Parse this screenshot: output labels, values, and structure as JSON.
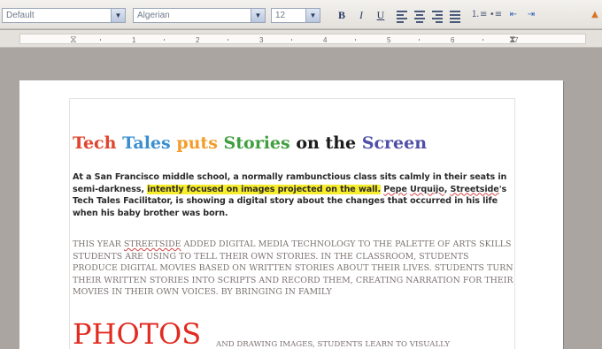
{
  "toolbar": {
    "paragraph_style": "Default",
    "font_name": "Algerian",
    "font_size": "12",
    "bold_label": "B",
    "italic_label": "I",
    "underline_label": "U"
  },
  "ruler": {
    "numbers": [
      "1",
      "2",
      "3",
      "4",
      "5",
      "6",
      "7"
    ]
  },
  "document": {
    "title_words": [
      {
        "text": "Tech",
        "color": "#e0442d"
      },
      {
        "text": "Tales",
        "color": "#3a8fd0"
      },
      {
        "text": "puts",
        "color": "#f39c2a"
      },
      {
        "text": "Stories",
        "color": "#3f9e3f"
      },
      {
        "text": "on the",
        "color": "#1a1a1a"
      },
      {
        "text": "Screen",
        "color": "#4f4fa8"
      }
    ],
    "para1": {
      "part1": "At a San Francisco middle school, a normally rambunctious class sits calmly in their seats in semi-darkness, ",
      "highlight": "intently focused on images projected on the wall.",
      "part2": " ",
      "name1": "Pepe",
      "space1": " ",
      "name2": "Urquijo",
      "part3": ", ",
      "org": "Streetside",
      "part4": "'s Tech Tales Facilitator, is showing a digital story about the changes that occurred in his life when his baby brother was born."
    },
    "para2": {
      "part1": "This year ",
      "org": "Streetside",
      "part2": " added digital media technology to the palette of arts skills students are using to tell their own stories. In the classroom, students produce digital movies based on written stories about their lives. Students turn their written stories into scripts and record them, creating narration for their movies in their own voices. By bringing in family"
    },
    "photos_big": "PHOTOS",
    "photos_rest": "and drawing images, students learn to visually"
  }
}
